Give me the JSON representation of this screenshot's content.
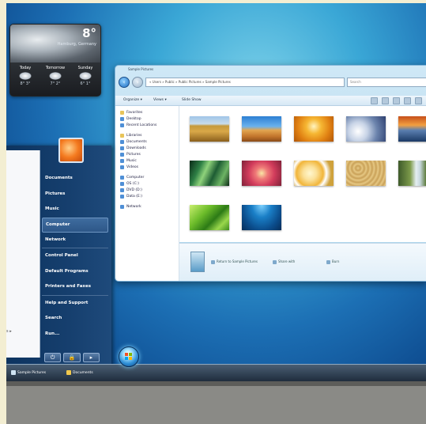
{
  "weather": {
    "temperature": "8°",
    "city": "Hamburg, Germany",
    "days": [
      {
        "label": "Today",
        "range": "8° 3°"
      },
      {
        "label": "Tomorrow",
        "range": "7° 2°"
      },
      {
        "label": "Sunday",
        "range": "6° 1°"
      }
    ]
  },
  "start_menu": {
    "items": [
      "Documents",
      "Pictures",
      "Music",
      "Computer",
      "Network",
      "Control Panel",
      "Default Programs",
      "Printers and Faxes",
      "Help and Support",
      "Search",
      "Run..."
    ],
    "power_buttons": [
      "⏻",
      "🔒",
      "▸"
    ]
  },
  "explorer": {
    "title": "Sample Pictures",
    "address": "« Users » Public » Public Pictures » Sample Pictures",
    "search_placeholder": "Search",
    "toolbar": {
      "organize": "Organize ▾",
      "views": "Views ▾",
      "slideshow": "Slide Show"
    },
    "nav_items": [
      {
        "label": "Favorites",
        "icon": "star-icon"
      },
      {
        "label": "Desktop",
        "icon": "desktop-icon"
      },
      {
        "label": "Recent Locations",
        "icon": "recent-icon"
      },
      {
        "label": "Libraries",
        "icon": "library-icon"
      },
      {
        "label": "Documents",
        "icon": "documents-icon"
      },
      {
        "label": "Downloads",
        "icon": "downloads-icon"
      },
      {
        "label": "Pictures",
        "icon": "pictures-icon"
      },
      {
        "label": "Music",
        "icon": "music-icon"
      },
      {
        "label": "Videos",
        "icon": "videos-icon"
      },
      {
        "label": "Computer",
        "icon": "computer-icon"
      },
      {
        "label": "OS (C:)",
        "icon": "drive-icon"
      },
      {
        "label": "DVD (D:)",
        "icon": "drive-icon"
      },
      {
        "label": "Data (E:)",
        "icon": "drive-icon"
      },
      {
        "label": "Network",
        "icon": "network-icon"
      }
    ],
    "thumbnails": [
      "wheat field",
      "desert dunes",
      "orange sun",
      "winter frost",
      "sunset lake",
      "green leaves",
      "pink flower",
      "white frangipani",
      "sand texture",
      "waterfall",
      "green leaf",
      "underwater blue"
    ],
    "details_tasks": [
      "Return to Sample Pictures",
      "Share with",
      "Burn"
    ]
  },
  "taskbar": {
    "items": [
      "Sample Pictures",
      "Documents"
    ]
  }
}
